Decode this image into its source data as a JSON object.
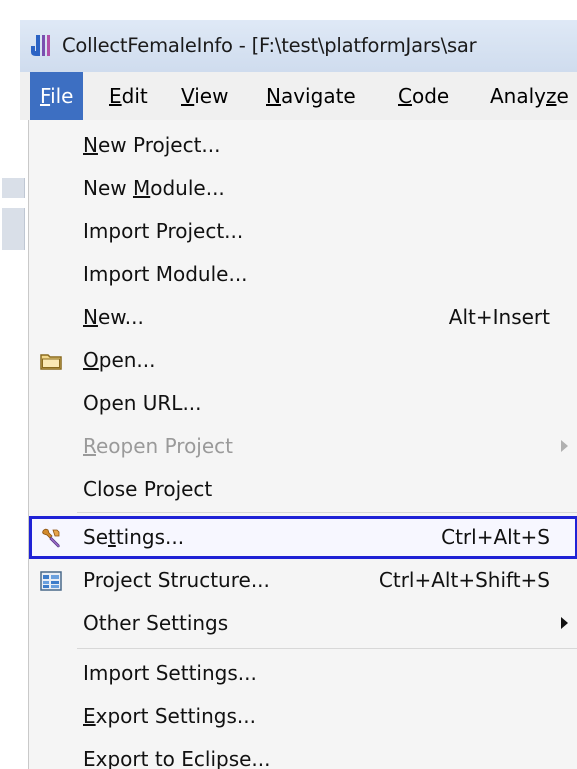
{
  "window": {
    "title": "CollectFemaleInfo - [F:\\test\\platformJars\\sar",
    "app_icon": "intellij-idea-icon"
  },
  "menubar": {
    "items": [
      {
        "label": "File",
        "mnemonic": "F",
        "rest": "ile"
      },
      {
        "label": "Edit",
        "mnemonic": "E",
        "rest": "dit"
      },
      {
        "label": "View",
        "mnemonic": "V",
        "rest": "iew"
      },
      {
        "label": "Navigate",
        "mnemonic": "N",
        "rest": "avigate"
      },
      {
        "label": "Code",
        "mnemonic": "C",
        "rest": "ode"
      },
      {
        "label": "Analyze",
        "pre": "Analy",
        "mnemonic": "z",
        "rest": "e"
      }
    ]
  },
  "file_menu": {
    "items": [
      {
        "pre": "",
        "mn": "N",
        "post": "ew Project...",
        "shortcut": ""
      },
      {
        "pre": "New ",
        "mn": "M",
        "post": "odule...",
        "shortcut": ""
      },
      {
        "pre": "Import Project...",
        "mn": "",
        "post": "",
        "shortcut": ""
      },
      {
        "pre": "Import Module...",
        "mn": "",
        "post": "",
        "shortcut": ""
      },
      {
        "pre": "",
        "mn": "N",
        "post": "ew...",
        "shortcut": "Alt+Insert"
      },
      {
        "pre": "",
        "mn": "O",
        "post": "pen...",
        "shortcut": "",
        "icon": "folder-icon"
      },
      {
        "pre": "Open URL...",
        "mn": "",
        "post": "",
        "shortcut": ""
      },
      {
        "pre": "",
        "mn": "R",
        "post": "eopen Project",
        "shortcut": "",
        "disabled": true,
        "submenu": true
      },
      {
        "pre": "Close Project",
        "mn": "",
        "post": "",
        "shortcut": ""
      },
      {
        "pre": "Se",
        "mn": "t",
        "post": "tings...",
        "shortcut": "Ctrl+Alt+S",
        "icon": "wrench-icon",
        "highlighted": true
      },
      {
        "pre": "Project Structure...",
        "mn": "",
        "post": "",
        "shortcut": "Ctrl+Alt+Shift+S",
        "icon": "project-structure-icon"
      },
      {
        "pre": "Other Settings",
        "mn": "",
        "post": "",
        "shortcut": "",
        "submenu": true
      },
      {
        "pre": "Import Settings...",
        "mn": "",
        "post": "",
        "shortcut": ""
      },
      {
        "pre": "",
        "mn": "E",
        "post": "xport Settings...",
        "shortcut": ""
      },
      {
        "pre": "Export to Eclipse...",
        "mn": "",
        "post": "",
        "shortcut": ""
      }
    ]
  }
}
